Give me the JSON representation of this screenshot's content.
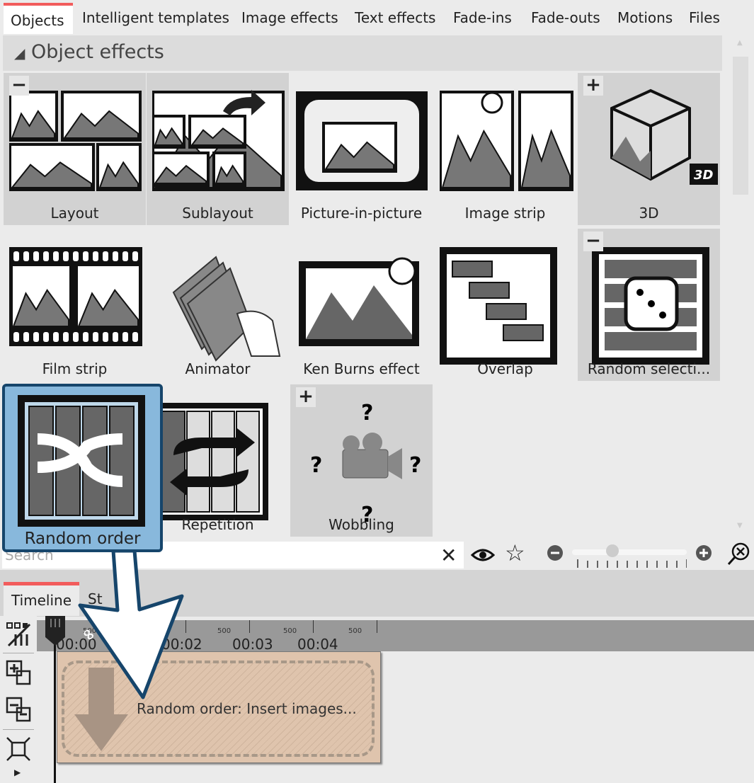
{
  "tabs": [
    {
      "label": "Objects",
      "active": true
    },
    {
      "label": "Intelligent templates"
    },
    {
      "label": "Image effects"
    },
    {
      "label": "Text effects"
    },
    {
      "label": "Fade-ins"
    },
    {
      "label": "Fade-outs"
    },
    {
      "label": "Motions"
    },
    {
      "label": "Files"
    }
  ],
  "section": {
    "title": "Object effects",
    "collapse_icon": "triangle-down-icon"
  },
  "effects": [
    {
      "label": "Layout",
      "toggle": "−"
    },
    {
      "label": "Sublayout"
    },
    {
      "label": "Picture-in-picture"
    },
    {
      "label": "Image strip"
    },
    {
      "label": "3D",
      "toggle": "+",
      "badge": "3D"
    },
    {
      "label": "Film strip"
    },
    {
      "label": "Animator"
    },
    {
      "label": "Ken Burns effect"
    },
    {
      "label": "Overlap"
    },
    {
      "label": "Random selecti...",
      "toggle": "−"
    },
    {
      "label": "Random order",
      "selected": true
    },
    {
      "label": "Repetition"
    },
    {
      "label": "Wobbling",
      "toggle": "+",
      "marks": "?"
    }
  ],
  "search": {
    "placeholder": "Search",
    "clear_icon": "close-icon"
  },
  "toolbar": {
    "icons": [
      "eye-icon",
      "star-icon",
      "zoom-out-icon",
      "zoom-in-icon",
      "zoom-fit-icon"
    ],
    "zoom_level": 0.35
  },
  "bottom_tabs": [
    {
      "label": "Timeline",
      "active": true
    },
    {
      "label": "St"
    }
  ],
  "ruler": {
    "sub_label": "500",
    "times": [
      "00:00",
      "00:02",
      "00:03",
      "00:04"
    ]
  },
  "clip": {
    "text": "Random order: Insert images..."
  },
  "colors": {
    "accent_tab": "#f25c5c",
    "selection": "#88b8dc",
    "selection_border": "#16456b",
    "clip": "#dfc4ad"
  }
}
